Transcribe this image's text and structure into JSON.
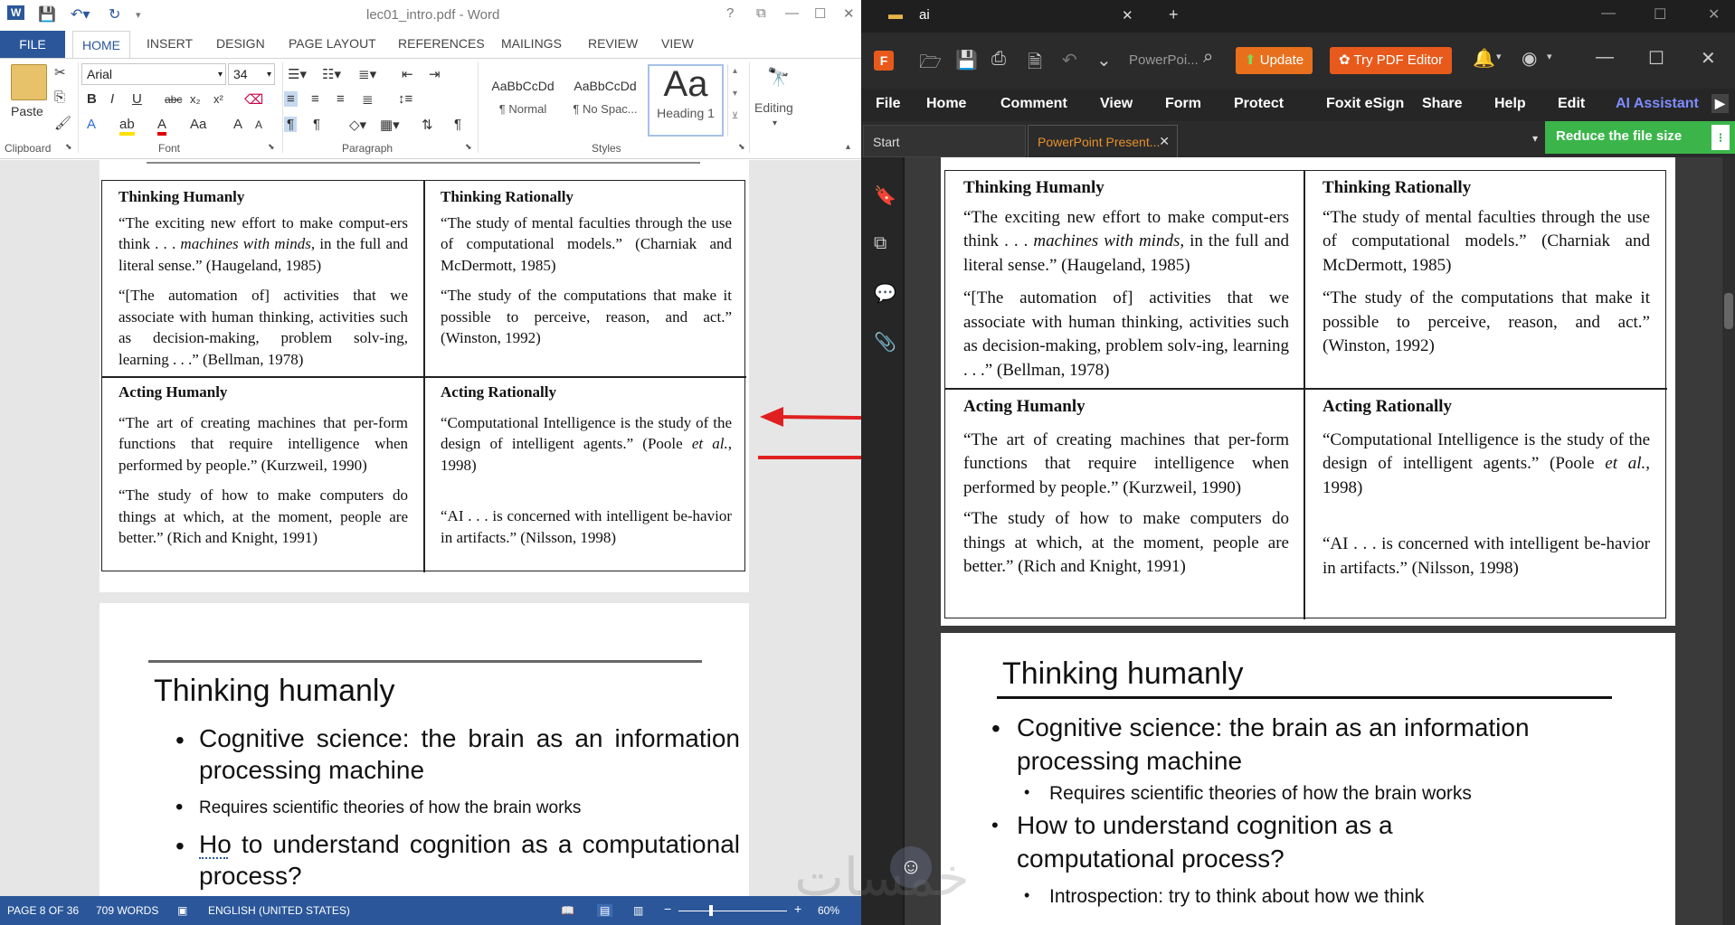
{
  "word": {
    "title": "lec01_intro.pdf - Word",
    "tabs": {
      "file": "FILE",
      "home": "HOME",
      "insert": "INSERT",
      "design": "DESIGN",
      "layout": "PAGE LAYOUT",
      "refs": "REFERENCES",
      "mail": "MAILINGS",
      "review": "REVIEW",
      "view": "VIEW"
    },
    "ribbon": {
      "paste": "Paste",
      "clipboard": "Clipboard",
      "font": "Font",
      "paragraph": "Paragraph",
      "styles": "Styles",
      "font_name": "Arial",
      "font_size": "34",
      "style_normal_sample": "AaBbCcDd",
      "style_normal": "¶ Normal",
      "style_nospace_sample": "AaBbCcDd",
      "style_nospace": "¶ No Spac...",
      "style_heading_sample": "Aa",
      "style_heading": "Heading 1",
      "editing": "Editing"
    },
    "status": {
      "page": "PAGE 8 OF 36",
      "words": "709 WORDS",
      "lang": "ENGLISH (UNITED STATES)",
      "zoom": "60%"
    }
  },
  "table": {
    "th_h": "Thinking Humanly",
    "th_q1a": "“The exciting new effort to make comput-ers think . . . ",
    "th_q1i": "machines with minds",
    "th_q1b": ", in the full and literal sense.” (Haugeland, 1985)",
    "th_q2": "“[The automation of] activities that we associate with human thinking, activities such as decision-making, problem solv-ing, learning . . .” (Bellman, 1978)",
    "tr_h": "Thinking Rationally",
    "tr_q1": "“The study of mental faculties through the use of computational models.” (Charniak and McDermott, 1985)",
    "tr_q2": "“The study of the computations that make it possible to perceive, reason, and act.” (Winston, 1992)",
    "ah_h": "Acting Humanly",
    "ah_q1": "“The art of creating machines that per-form functions that require intelligence when performed by people.” (Kurzweil, 1990)",
    "ah_q2": "“The study of how to make computers do things at which, at the moment, people are better.” (Rich and Knight, 1991)",
    "ar_h": "Acting Rationally",
    "ar_q1a": "“Computational Intelligence is the study of the design of intelligent agents.” (Poole ",
    "ar_q1i": "et al.",
    "ar_q1b": ", 1998)",
    "ar_q2": "“AI . . . is concerned with intelligent be-havior in artifacts.” (Nilsson, 1998)"
  },
  "slide": {
    "title": "Thinking humanly",
    "b1": "Cognitive science: the brain as an information processing machine",
    "b2": "Requires scientific theories of how the brain works",
    "b3": "Ho to understand cognition as a  computational process?",
    "b3_pdf": "How to understand cognition as a computational process?",
    "b4": "Introspection: try to think about how we think"
  },
  "foxit": {
    "window_tab": "ai",
    "search_label": "PowerPoi...",
    "update": "Update",
    "try_editor": "Try PDF Editor",
    "menu": {
      "file": "File",
      "home": "Home",
      "comment": "Comment",
      "view": "View",
      "form": "Form",
      "protect": "Protect",
      "esign": "Foxit eSign",
      "share": "Share",
      "help": "Help",
      "edit": "Edit",
      "ai": "AI Assistant"
    },
    "tab_start": "Start",
    "tab_doc": "PowerPoint Present...",
    "reduce": "Reduce the file size"
  },
  "watermark": "خمسات",
  "colors": {
    "word_blue": "#2b579a",
    "foxit_orange": "#e85a1c",
    "reduce_green": "#3bb54a",
    "arrow_red": "#e02020"
  }
}
